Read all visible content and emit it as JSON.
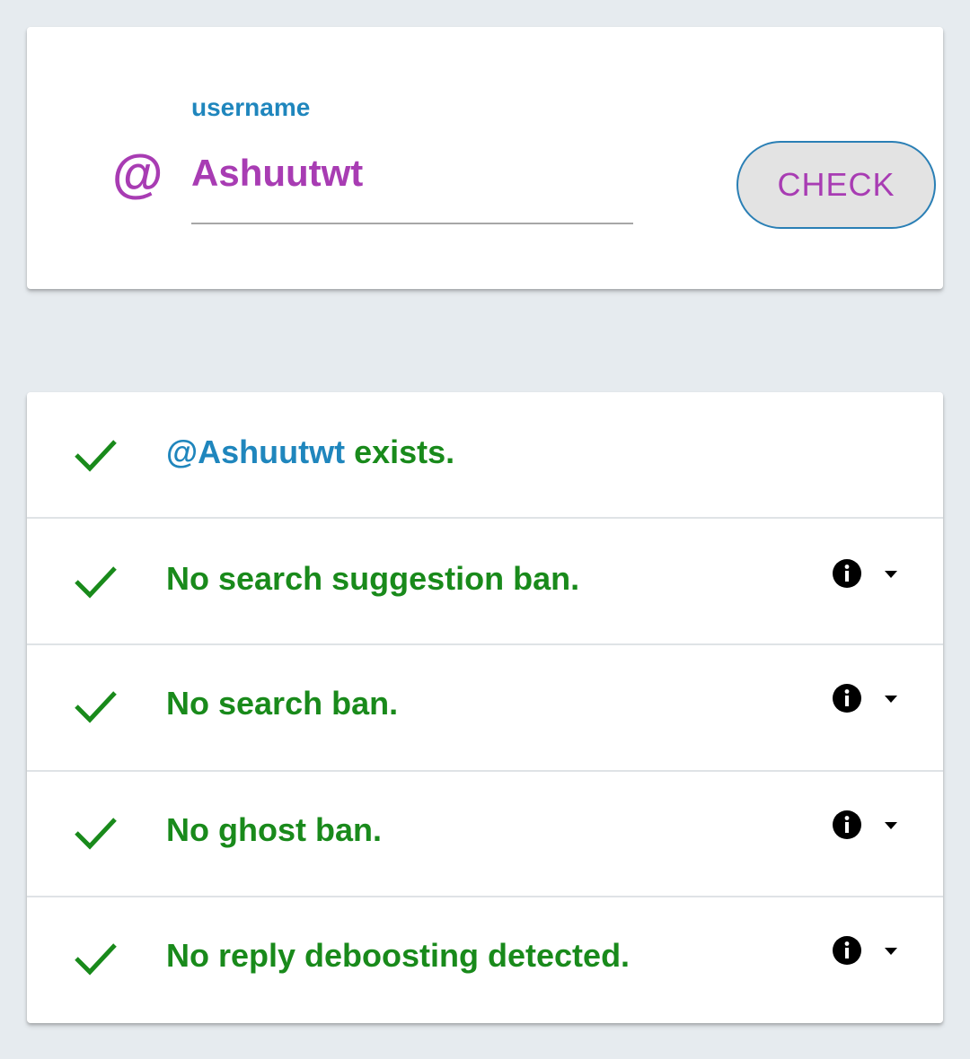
{
  "form": {
    "icon": "at-icon",
    "icon_glyph": "@",
    "label": "username",
    "value": "Ashuutwt",
    "check_label": "CHECK"
  },
  "results": [
    {
      "handle": "@Ashuutwt",
      "text": " exists.",
      "status": "ok",
      "has_info": false
    },
    {
      "text": "No search suggestion ban.",
      "status": "ok",
      "has_info": true
    },
    {
      "text": "No search ban.",
      "status": "ok",
      "has_info": true
    },
    {
      "text": "No ghost ban.",
      "status": "ok",
      "has_info": true
    },
    {
      "text": "No reply deboosting detected.",
      "status": "ok",
      "has_info": true
    }
  ],
  "colors": {
    "background": "#e6ebef",
    "accent_purple": "#a83cb3",
    "accent_blue": "#1f86bd",
    "success_green": "#198a1b"
  }
}
